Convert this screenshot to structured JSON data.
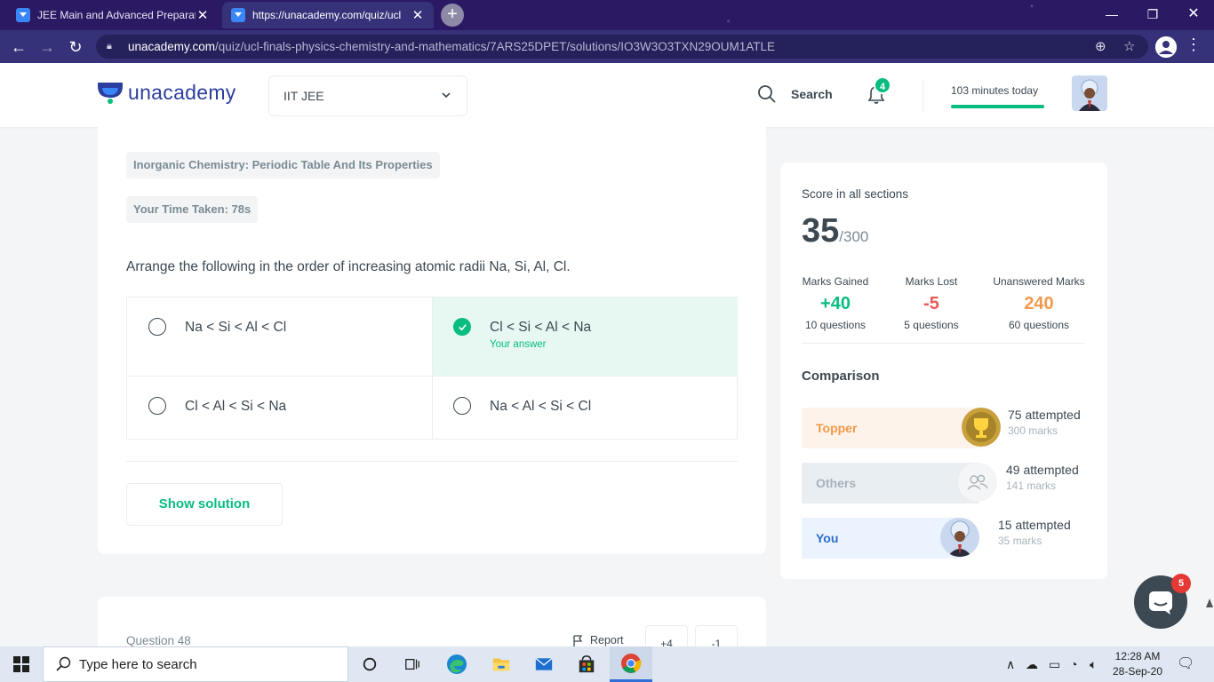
{
  "browser": {
    "tabs": [
      {
        "title": "JEE Main and Advanced Preparat",
        "active": false
      },
      {
        "title": "https://unacademy.com/quiz/ucl",
        "active": true
      }
    ],
    "new_tab_label": "+",
    "url_host": "unacademy.com",
    "url_path": "/quiz/ucl-finals-physics-chemistry-and-mathematics/7ARS25DPET/solutions/IO3W3O3TXN29OUM1ATLE"
  },
  "header": {
    "brand": "unacademy",
    "goal": "IIT JEE",
    "search_label": "Search",
    "notification_count": "4",
    "minutes_today": "103 minutes today",
    "minutes_progress": 1.0
  },
  "question": {
    "topic": "Inorganic Chemistry: Periodic Table And Its Properties",
    "time_taken": "Your Time Taken: 78s",
    "text": "Arrange the following in the order of increasing atomic radii Na, Si, Al, Cl.",
    "options": [
      {
        "text": "Na < Si < Al < Cl",
        "selected": false
      },
      {
        "text": "Cl < Si < Al < Na",
        "selected": true,
        "note": "Your answer"
      },
      {
        "text": "Cl < Al < Si < Na",
        "selected": false
      },
      {
        "text": "Na < Al < Si < Cl",
        "selected": false
      }
    ],
    "show_solution": "Show solution"
  },
  "next_question": {
    "label": "Question 48",
    "report": "Report",
    "plus_marks": "+4",
    "minus_marks": "-1"
  },
  "score": {
    "title": "Score in all sections",
    "value": "35",
    "total": "/300",
    "stats": [
      {
        "label": "Marks Gained",
        "value": "+40",
        "count": "10 questions",
        "color": "#08bd80"
      },
      {
        "label": "Marks Lost",
        "value": "-5",
        "count": "5 questions",
        "color": "#eb5757"
      },
      {
        "label": "Unanswered Marks",
        "value": "240",
        "count": "60 questions",
        "color": "#f2994a"
      }
    ],
    "comparison_title": "Comparison",
    "comparison": [
      {
        "name": "Topper",
        "attempted": "75 attempted",
        "marks": "300 marks",
        "bg": "#fef3ea",
        "color": "#f2994a"
      },
      {
        "name": "Others",
        "attempted": "49 attempted",
        "marks": "141 marks",
        "bg": "#e9eef2",
        "color": "#a7b3ba"
      },
      {
        "name": "You",
        "attempted": "15 attempted",
        "marks": "35 marks",
        "bg": "#eaf3fe",
        "color": "#2c6fc9"
      }
    ]
  },
  "chat": {
    "badge": "5"
  },
  "taskbar": {
    "search_placeholder": "Type here to search",
    "time": "12:28 AM",
    "date": "28-Sep-20"
  },
  "colors": {
    "accent": "#08bd80",
    "text": "#3c4852",
    "browser_frame": "#35327a"
  }
}
